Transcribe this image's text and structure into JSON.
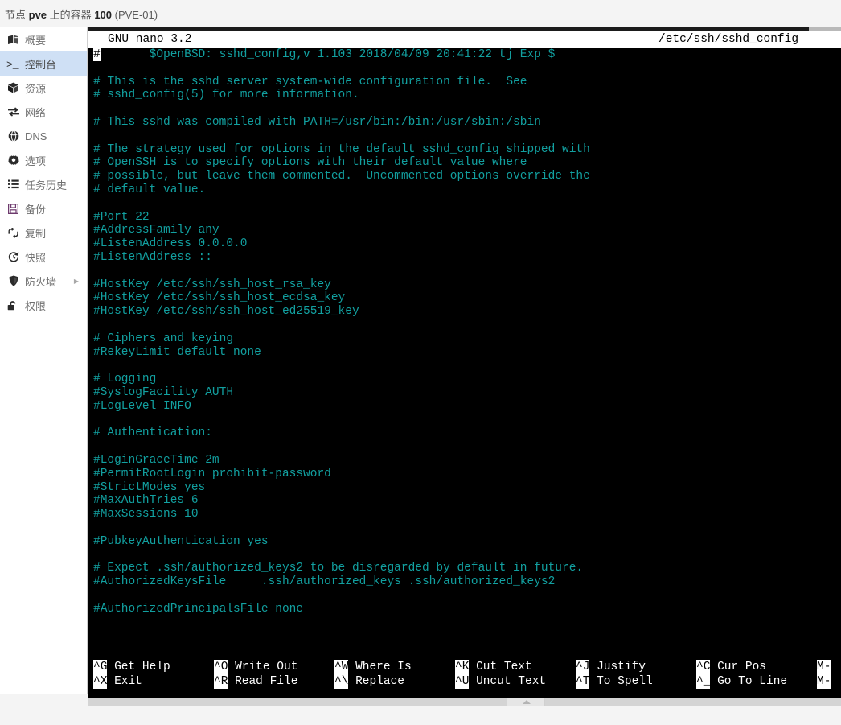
{
  "breadcrumb": {
    "prefix": "节点",
    "node": "pve",
    "middle": "上的容器",
    "vmid": "100",
    "name": "(PVE-01)",
    "full": "节点 pve 上的容器 100 (PVE-01)"
  },
  "sidebar": {
    "items": [
      {
        "label": "概要",
        "icon": "book-icon",
        "selected": false,
        "arrow": false
      },
      {
        "label": "控制台",
        "icon": "terminal-icon",
        "selected": true,
        "arrow": false
      },
      {
        "label": "资源",
        "icon": "cube-icon",
        "selected": false,
        "arrow": false
      },
      {
        "label": "网络",
        "icon": "network-icon",
        "selected": false,
        "arrow": false
      },
      {
        "label": "DNS",
        "icon": "globe-icon",
        "selected": false,
        "arrow": false
      },
      {
        "label": "选项",
        "icon": "gear-icon",
        "selected": false,
        "arrow": false
      },
      {
        "label": "任务历史",
        "icon": "list-icon",
        "selected": false,
        "arrow": false
      },
      {
        "label": "备份",
        "icon": "floppy-icon",
        "selected": false,
        "arrow": false
      },
      {
        "label": "复制",
        "icon": "replicate-icon",
        "selected": false,
        "arrow": false
      },
      {
        "label": "快照",
        "icon": "clock-icon",
        "selected": false,
        "arrow": false
      },
      {
        "label": "防火墙",
        "icon": "shield-icon",
        "selected": false,
        "arrow": true
      },
      {
        "label": "权限",
        "icon": "unlock-icon",
        "selected": false,
        "arrow": false
      }
    ]
  },
  "terminal": {
    "editor_title": "GNU nano 3.2",
    "file_path": "/etc/ssh/sshd_config",
    "cursor_char": "#",
    "colors": {
      "background": "#000000",
      "text": "#12a0a0",
      "titlebar_bg": "#ffffff",
      "titlebar_fg": "#000000",
      "shortcut_fg": "#ffffff",
      "accent_selected": "#cfe0f5"
    },
    "lines": [
      "#\t$OpenBSD: sshd_config,v 1.103 2018/04/09 20:41:22 tj Exp $",
      "",
      "# This is the sshd server system-wide configuration file.  See",
      "# sshd_config(5) for more information.",
      "",
      "# This sshd was compiled with PATH=/usr/bin:/bin:/usr/sbin:/sbin",
      "",
      "# The strategy used for options in the default sshd_config shipped with",
      "# OpenSSH is to specify options with their default value where",
      "# possible, but leave them commented.  Uncommented options override the",
      "# default value.",
      "",
      "#Port 22",
      "#AddressFamily any",
      "#ListenAddress 0.0.0.0",
      "#ListenAddress ::",
      "",
      "#HostKey /etc/ssh/ssh_host_rsa_key",
      "#HostKey /etc/ssh/ssh_host_ecdsa_key",
      "#HostKey /etc/ssh/ssh_host_ed25519_key",
      "",
      "# Ciphers and keying",
      "#RekeyLimit default none",
      "",
      "# Logging",
      "#SyslogFacility AUTH",
      "#LogLevel INFO",
      "",
      "# Authentication:",
      "",
      "#LoginGraceTime 2m",
      "#PermitRootLogin prohibit-password",
      "#StrictModes yes",
      "#MaxAuthTries 6",
      "#MaxSessions 10",
      "",
      "#PubkeyAuthentication yes",
      "",
      "# Expect .ssh/authorized_keys2 to be disregarded by default in future.",
      "#AuthorizedKeysFile\t.ssh/authorized_keys .ssh/authorized_keys2",
      "",
      "#AuthorizedPrincipalsFile none"
    ],
    "shortcuts": [
      {
        "key1": "^G",
        "label1": "Get Help",
        "key2": "^X",
        "label2": "Exit"
      },
      {
        "key1": "^O",
        "label1": "Write Out",
        "key2": "^R",
        "label2": "Read File"
      },
      {
        "key1": "^W",
        "label1": "Where Is",
        "key2": "^\\",
        "label2": "Replace"
      },
      {
        "key1": "^K",
        "label1": "Cut Text",
        "key2": "^U",
        "label2": "Uncut Text"
      },
      {
        "key1": "^J",
        "label1": "Justify",
        "key2": "^T",
        "label2": "To Spell"
      },
      {
        "key1": "^C",
        "label1": "Cur Pos",
        "key2": "^_",
        "label2": "Go To Line"
      },
      {
        "key1": "M-",
        "label1": "",
        "key2": "M-",
        "label2": ""
      }
    ]
  }
}
